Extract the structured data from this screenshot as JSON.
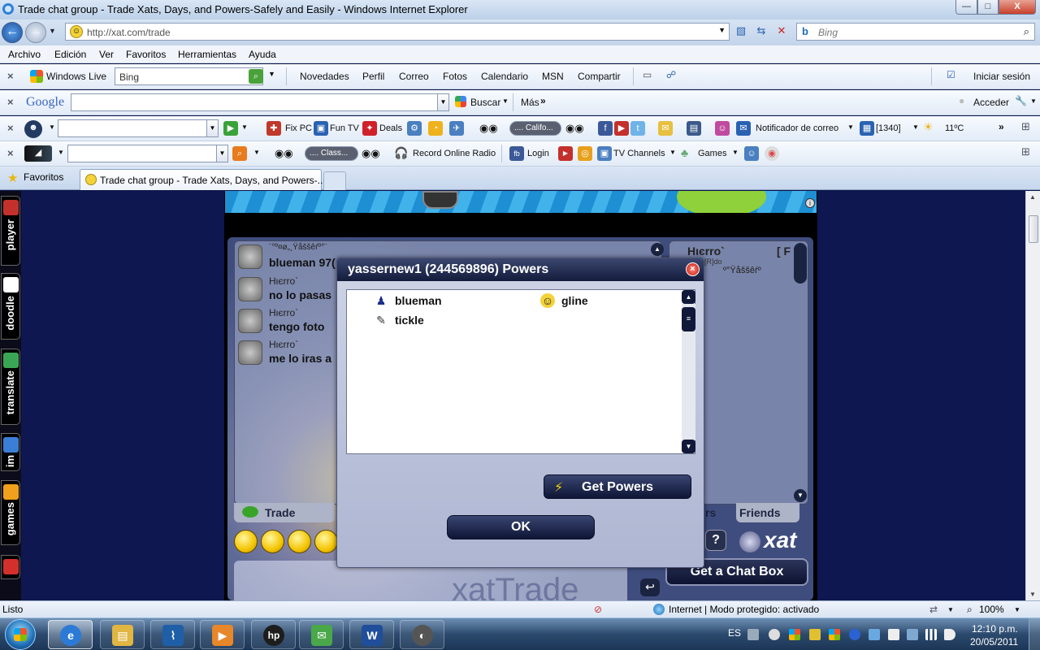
{
  "window": {
    "title": "Trade chat group - Trade Xats, Days, and Powers-Safely and Easily - Windows Internet Explorer",
    "min_glyph": "—",
    "max_glyph": "□",
    "close_glyph": "X"
  },
  "address": {
    "url": "http://xat.com/trade",
    "search_placeholder": "Bing",
    "search_logo": "b"
  },
  "menu": [
    "Archivo",
    "Edición",
    "Ver",
    "Favoritos",
    "Herramientas",
    "Ayuda"
  ],
  "live_toolbar": {
    "brand": "Windows Live",
    "search_value": "Bing",
    "links": [
      "Novedades",
      "Perfil",
      "Correo",
      "Fotos",
      "Calendario",
      "MSN",
      "Compartir"
    ],
    "signin": "Iniciar sesión"
  },
  "google_toolbar": {
    "brand": "Google",
    "search_button": "Buscar",
    "more": "Más",
    "signin": "Acceder"
  },
  "ext_toolbar1": {
    "fixpc": "Fix PC",
    "funtv": "Fun TV",
    "deals": "Deals",
    "radio": ".... Califo...",
    "mail_notifier": "Notificador de correo",
    "count": "[1340]",
    "weather": "11ºC"
  },
  "ext_toolbar2": {
    "radio": ".... Class...",
    "record": "Record Online Radio",
    "login": "Login",
    "tv": "TV Channels",
    "games": "Games"
  },
  "tabs": {
    "favorites": "Favoritos",
    "active_tab": "Trade chat group - Trade Xats, Days, and Powers-..."
  },
  "sidebar": [
    {
      "label": "player",
      "color": "#c4302b"
    },
    {
      "label": "doodle",
      "color": "#ffffff"
    },
    {
      "label": "translate",
      "color": "#3aa655"
    },
    {
      "label": "im",
      "color": "#3b7ed8"
    },
    {
      "label": "games",
      "color": "#f0a01c"
    }
  ],
  "chat": {
    "messages": [
      {
        "name": "¨°º¤ø„¸Ÿåššêŕº°¨",
        "text": "blueman 97("
      },
      {
        "name": "Hιєrro`",
        "text": "no lo pasas"
      },
      {
        "name": "Hιєrro`",
        "text": "tengo foto"
      },
      {
        "name": "Hιєrro`",
        "text": "me lo iras a"
      }
    ],
    "users": {
      "top_name": "Hιєrro`",
      "top_tag": "[ F",
      "top_sub": "Ŝdua[R]do",
      "second": "º°Ÿåššêŕº"
    },
    "tab_trade": "Trade",
    "tab_friends_partial": "rs",
    "tab_friends": "Friends",
    "help": "?",
    "logo": "xat",
    "watermark": "xatTrade",
    "get_chat_box": "Get a Chat Box",
    "send": "↩"
  },
  "powers_dialog": {
    "title": "yassernew1 (244569896) Powers",
    "close": "×",
    "powers": [
      {
        "name": "blueman",
        "icon": "person-icon",
        "glyph": "♟",
        "color": "#1b2e8c"
      },
      {
        "name": "gline",
        "icon": "sunglasses-smiley-icon",
        "glyph": "☺",
        "color": "#b58900"
      },
      {
        "name": "tickle",
        "icon": "feather-icon",
        "glyph": "✎",
        "color": "#333333"
      }
    ],
    "get_powers": "Get Powers",
    "ok": "OK"
  },
  "status": {
    "left": "Listo",
    "zone": "Internet | Modo protegido: activado",
    "zoom": "100%"
  },
  "taskbar": {
    "lang": "ES",
    "time": "12:10 p.m.",
    "date": "20/05/2011",
    "apps": [
      {
        "name": "internet-explorer",
        "glyph": "e",
        "color": "#2b7bd6",
        "active": true
      },
      {
        "name": "file-explorer",
        "glyph": "▤",
        "color": "#e1b542"
      },
      {
        "name": "stocks",
        "glyph": "⌇",
        "color": "#1f5fa8"
      },
      {
        "name": "media-player",
        "glyph": "▶",
        "color": "#e8862a"
      },
      {
        "name": "hp",
        "glyph": "hp",
        "color": "#1d1d1d"
      },
      {
        "name": "messenger",
        "glyph": "✉",
        "color": "#4aa84a"
      },
      {
        "name": "word",
        "glyph": "W",
        "color": "#1f4e9a"
      },
      {
        "name": "recorder",
        "glyph": "◐",
        "color": "#555555"
      }
    ]
  },
  "colors": {
    "dialog_title_bg": "#1b2448",
    "page_bg": "#0e1750",
    "accent_blue": "#2b7bd6"
  }
}
